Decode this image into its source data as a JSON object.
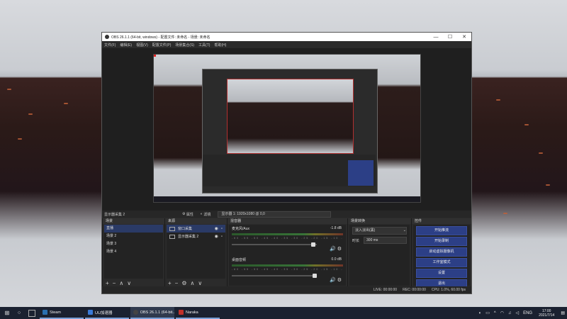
{
  "window": {
    "title": "OBS 26.1.1 (64-bit, windows) - 配置文件: 未命名 - 场景: 未命名",
    "controls": [
      "—",
      "☐",
      "✕"
    ]
  },
  "menu": [
    "文件(F)",
    "编辑(E)",
    "视图(V)",
    "配置文件(P)",
    "场景集合(S)",
    "工具(T)",
    "帮助(H)"
  ],
  "scene_bar": {
    "current_scene": "显示器采集 2",
    "properties": "属性",
    "filters": "滤镜",
    "display": "显示器 1: 1920x1080 @ 0,0"
  },
  "scenes": {
    "title": "场景",
    "items": [
      "直播",
      "场景 2",
      "场景 3",
      "场景 4"
    ]
  },
  "sources": {
    "title": "来源",
    "items": [
      "窗口采集",
      "显示器采集 2"
    ]
  },
  "mixer": {
    "title": "混音器",
    "channels": [
      {
        "name": "麦克风/Aux",
        "db": "-1.8 dB"
      },
      {
        "name": "桌面音频",
        "db": "0.0 dB"
      }
    ],
    "ticks": "-60 -55 -50 -45 -40 -35 -30 -25 -20 -15 -10 -5 0"
  },
  "transitions": {
    "title": "场景转换",
    "type": "淡入淡出(黑)",
    "duration_label": "时长",
    "duration": "300 ms"
  },
  "controls": {
    "title": "控件",
    "buttons": [
      "开始推流",
      "开始录制",
      "启动虚拟摄像机",
      "工作室模式",
      "设置",
      "退出"
    ]
  },
  "status": {
    "live": "LIVE: 00:00:00",
    "rec": "REC: 00:00:00",
    "cpu": "CPU: 1.0%, 60.00 fps"
  },
  "taskbar": {
    "apps": [
      {
        "label": "Steam",
        "color": "#2a6fb0"
      },
      {
        "label": "UU加速器",
        "color": "#3a7ad8"
      },
      {
        "label": "OBS 26.1.1 (64-bit...",
        "color": "#444444"
      },
      {
        "label": "Naraka",
        "color": "#c0302a"
      }
    ],
    "lang": "ENG",
    "time": "17:00",
    "date": "2021/7/14"
  }
}
